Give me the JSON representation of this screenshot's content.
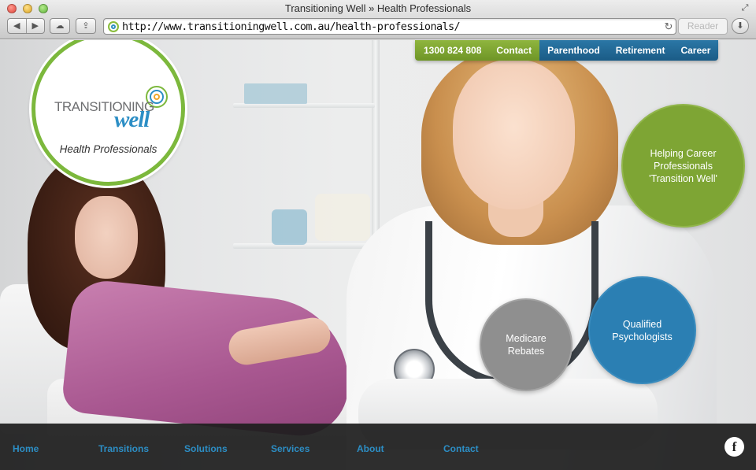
{
  "window": {
    "title": "Transitioning Well  »  Health Professionals"
  },
  "toolbar": {
    "back_icon": "◀",
    "forward_icon": "▶",
    "icloud_icon": "☁",
    "share_icon": "⇪",
    "url": "http://www.transitioningwell.com.au/health-professionals/",
    "reload_icon": "↻",
    "reader_label": "Reader",
    "download_icon": "⬇",
    "fullscreen_icon": "⤢"
  },
  "logo": {
    "word1": "TRANSITIONING",
    "word2": "well",
    "subtitle": "Health Professionals"
  },
  "topnav": {
    "phone": "1300 824 808",
    "contact": "Contact",
    "items": [
      "Parenthood",
      "Retirement",
      "Career"
    ]
  },
  "circles": {
    "career": "Helping Career Professionals 'Transition Well'",
    "psych": "Qualified Psychologists",
    "medicare": "Medicare Rebates"
  },
  "footer": {
    "links": [
      "Home",
      "Transitions",
      "Solutions",
      "Services",
      "About",
      "Contact"
    ],
    "facebook": "f"
  },
  "colors": {
    "green": "#7ea534",
    "blue": "#2b7fb3",
    "grey": "#8f8f8f",
    "footer_link": "#2c8ec5"
  }
}
